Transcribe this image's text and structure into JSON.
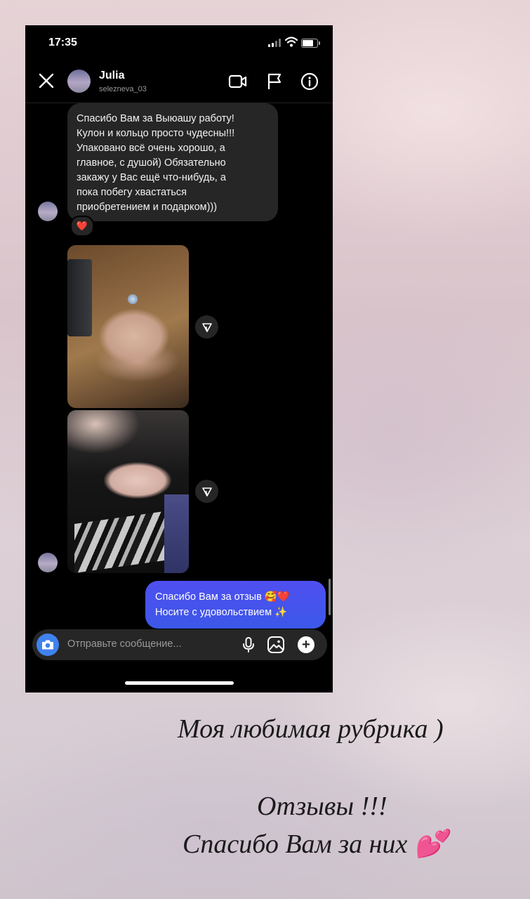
{
  "status_bar": {
    "time": "17:35"
  },
  "header": {
    "name": "Julia",
    "username": "selezneva_03"
  },
  "messages": {
    "incoming_text": "Спасибо Вам за Выюашу работу!\nКулон и кольцо просто чудесны!!!\nУпаковано всё очень хорошо, а\nглавное, с душой) Обязательно\nзакажу у Вас ещё что-нибудь, а\nпока побегу хвастаться\nприобретением и подарком)))",
    "reaction": "❤️",
    "outgoing_line1": "Спасибо Вам за отзыв 🥰❤️",
    "outgoing_line2": "Носите с удовольствием ✨"
  },
  "composer": {
    "placeholder": "Отправьте сообщение..."
  },
  "caption": {
    "line1": "Моя любимая рубрика )",
    "line2": "Отзывы !!!",
    "line3": "Спасибо Вам за них 💕"
  },
  "icons": [
    "close-icon",
    "video-call-icon",
    "flag-icon",
    "info-icon",
    "share-icon",
    "camera-icon",
    "microphone-icon",
    "gallery-icon",
    "plus-icon"
  ]
}
